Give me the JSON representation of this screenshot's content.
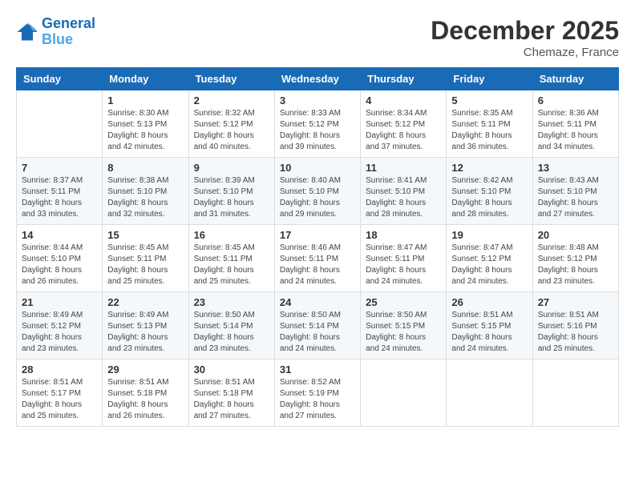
{
  "logo": {
    "line1": "General",
    "line2": "Blue"
  },
  "title": "December 2025",
  "location": "Chemaze, France",
  "weekdays": [
    "Sunday",
    "Monday",
    "Tuesday",
    "Wednesday",
    "Thursday",
    "Friday",
    "Saturday"
  ],
  "weeks": [
    [
      {
        "day": "",
        "sunrise": "",
        "sunset": "",
        "daylight": ""
      },
      {
        "day": "1",
        "sunrise": "Sunrise: 8:30 AM",
        "sunset": "Sunset: 5:13 PM",
        "daylight": "Daylight: 8 hours and 42 minutes."
      },
      {
        "day": "2",
        "sunrise": "Sunrise: 8:32 AM",
        "sunset": "Sunset: 5:12 PM",
        "daylight": "Daylight: 8 hours and 40 minutes."
      },
      {
        "day": "3",
        "sunrise": "Sunrise: 8:33 AM",
        "sunset": "Sunset: 5:12 PM",
        "daylight": "Daylight: 8 hours and 39 minutes."
      },
      {
        "day": "4",
        "sunrise": "Sunrise: 8:34 AM",
        "sunset": "Sunset: 5:12 PM",
        "daylight": "Daylight: 8 hours and 37 minutes."
      },
      {
        "day": "5",
        "sunrise": "Sunrise: 8:35 AM",
        "sunset": "Sunset: 5:11 PM",
        "daylight": "Daylight: 8 hours and 36 minutes."
      },
      {
        "day": "6",
        "sunrise": "Sunrise: 8:36 AM",
        "sunset": "Sunset: 5:11 PM",
        "daylight": "Daylight: 8 hours and 34 minutes."
      }
    ],
    [
      {
        "day": "7",
        "sunrise": "Sunrise: 8:37 AM",
        "sunset": "Sunset: 5:11 PM",
        "daylight": "Daylight: 8 hours and 33 minutes."
      },
      {
        "day": "8",
        "sunrise": "Sunrise: 8:38 AM",
        "sunset": "Sunset: 5:10 PM",
        "daylight": "Daylight: 8 hours and 32 minutes."
      },
      {
        "day": "9",
        "sunrise": "Sunrise: 8:39 AM",
        "sunset": "Sunset: 5:10 PM",
        "daylight": "Daylight: 8 hours and 31 minutes."
      },
      {
        "day": "10",
        "sunrise": "Sunrise: 8:40 AM",
        "sunset": "Sunset: 5:10 PM",
        "daylight": "Daylight: 8 hours and 29 minutes."
      },
      {
        "day": "11",
        "sunrise": "Sunrise: 8:41 AM",
        "sunset": "Sunset: 5:10 PM",
        "daylight": "Daylight: 8 hours and 28 minutes."
      },
      {
        "day": "12",
        "sunrise": "Sunrise: 8:42 AM",
        "sunset": "Sunset: 5:10 PM",
        "daylight": "Daylight: 8 hours and 28 minutes."
      },
      {
        "day": "13",
        "sunrise": "Sunrise: 8:43 AM",
        "sunset": "Sunset: 5:10 PM",
        "daylight": "Daylight: 8 hours and 27 minutes."
      }
    ],
    [
      {
        "day": "14",
        "sunrise": "Sunrise: 8:44 AM",
        "sunset": "Sunset: 5:10 PM",
        "daylight": "Daylight: 8 hours and 26 minutes."
      },
      {
        "day": "15",
        "sunrise": "Sunrise: 8:45 AM",
        "sunset": "Sunset: 5:11 PM",
        "daylight": "Daylight: 8 hours and 25 minutes."
      },
      {
        "day": "16",
        "sunrise": "Sunrise: 8:45 AM",
        "sunset": "Sunset: 5:11 PM",
        "daylight": "Daylight: 8 hours and 25 minutes."
      },
      {
        "day": "17",
        "sunrise": "Sunrise: 8:46 AM",
        "sunset": "Sunset: 5:11 PM",
        "daylight": "Daylight: 8 hours and 24 minutes."
      },
      {
        "day": "18",
        "sunrise": "Sunrise: 8:47 AM",
        "sunset": "Sunset: 5:11 PM",
        "daylight": "Daylight: 8 hours and 24 minutes."
      },
      {
        "day": "19",
        "sunrise": "Sunrise: 8:47 AM",
        "sunset": "Sunset: 5:12 PM",
        "daylight": "Daylight: 8 hours and 24 minutes."
      },
      {
        "day": "20",
        "sunrise": "Sunrise: 8:48 AM",
        "sunset": "Sunset: 5:12 PM",
        "daylight": "Daylight: 8 hours and 23 minutes."
      }
    ],
    [
      {
        "day": "21",
        "sunrise": "Sunrise: 8:49 AM",
        "sunset": "Sunset: 5:12 PM",
        "daylight": "Daylight: 8 hours and 23 minutes."
      },
      {
        "day": "22",
        "sunrise": "Sunrise: 8:49 AM",
        "sunset": "Sunset: 5:13 PM",
        "daylight": "Daylight: 8 hours and 23 minutes."
      },
      {
        "day": "23",
        "sunrise": "Sunrise: 8:50 AM",
        "sunset": "Sunset: 5:14 PM",
        "daylight": "Daylight: 8 hours and 23 minutes."
      },
      {
        "day": "24",
        "sunrise": "Sunrise: 8:50 AM",
        "sunset": "Sunset: 5:14 PM",
        "daylight": "Daylight: 8 hours and 24 minutes."
      },
      {
        "day": "25",
        "sunrise": "Sunrise: 8:50 AM",
        "sunset": "Sunset: 5:15 PM",
        "daylight": "Daylight: 8 hours and 24 minutes."
      },
      {
        "day": "26",
        "sunrise": "Sunrise: 8:51 AM",
        "sunset": "Sunset: 5:15 PM",
        "daylight": "Daylight: 8 hours and 24 minutes."
      },
      {
        "day": "27",
        "sunrise": "Sunrise: 8:51 AM",
        "sunset": "Sunset: 5:16 PM",
        "daylight": "Daylight: 8 hours and 25 minutes."
      }
    ],
    [
      {
        "day": "28",
        "sunrise": "Sunrise: 8:51 AM",
        "sunset": "Sunset: 5:17 PM",
        "daylight": "Daylight: 8 hours and 25 minutes."
      },
      {
        "day": "29",
        "sunrise": "Sunrise: 8:51 AM",
        "sunset": "Sunset: 5:18 PM",
        "daylight": "Daylight: 8 hours and 26 minutes."
      },
      {
        "day": "30",
        "sunrise": "Sunrise: 8:51 AM",
        "sunset": "Sunset: 5:18 PM",
        "daylight": "Daylight: 8 hours and 27 minutes."
      },
      {
        "day": "31",
        "sunrise": "Sunrise: 8:52 AM",
        "sunset": "Sunset: 5:19 PM",
        "daylight": "Daylight: 8 hours and 27 minutes."
      },
      {
        "day": "",
        "sunrise": "",
        "sunset": "",
        "daylight": ""
      },
      {
        "day": "",
        "sunrise": "",
        "sunset": "",
        "daylight": ""
      },
      {
        "day": "",
        "sunrise": "",
        "sunset": "",
        "daylight": ""
      }
    ]
  ]
}
